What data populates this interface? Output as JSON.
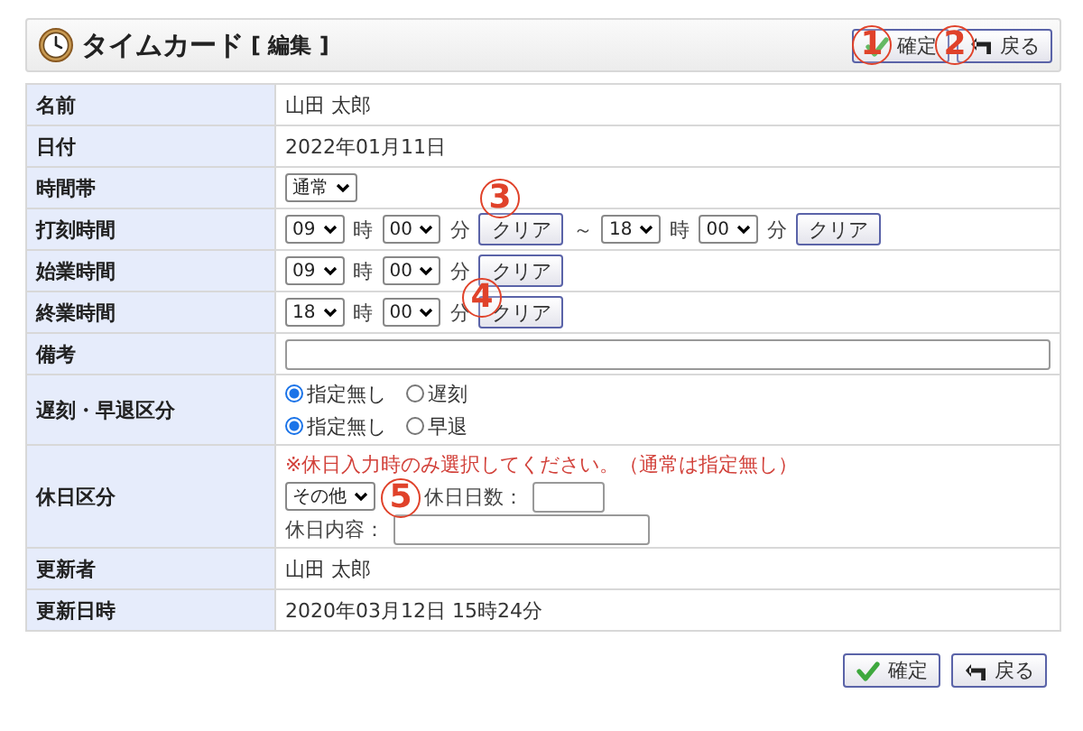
{
  "header": {
    "title": "タイムカード",
    "mode": "[ 編集 ]",
    "buttons": [
      {
        "kind": "confirm",
        "label": "確定"
      },
      {
        "kind": "back",
        "label": "戻る"
      }
    ]
  },
  "rows": [
    {
      "label": "名前",
      "kind": "text",
      "value": "山田 太郎"
    },
    {
      "label": "日付",
      "kind": "text",
      "value": "2022年01月11日"
    },
    {
      "label": "時間帯",
      "kind": "controls",
      "lines": [
        [
          {
            "kind": "select",
            "value": "通常"
          }
        ]
      ]
    },
    {
      "label": "打刻時間",
      "kind": "controls",
      "lines": [
        [
          {
            "kind": "select",
            "value": "09"
          },
          {
            "kind": "unit",
            "text": "時"
          },
          {
            "kind": "select",
            "value": "00"
          },
          {
            "kind": "unit",
            "text": "分"
          },
          {
            "kind": "button",
            "text": "クリア"
          },
          {
            "kind": "unit",
            "text": "～"
          },
          {
            "kind": "select",
            "value": "18"
          },
          {
            "kind": "unit",
            "text": "時"
          },
          {
            "kind": "select",
            "value": "00"
          },
          {
            "kind": "unit",
            "text": "分"
          },
          {
            "kind": "button",
            "text": "クリア"
          }
        ]
      ]
    },
    {
      "label": "始業時間",
      "kind": "controls",
      "lines": [
        [
          {
            "kind": "select",
            "value": "09"
          },
          {
            "kind": "unit",
            "text": "時"
          },
          {
            "kind": "select",
            "value": "00"
          },
          {
            "kind": "unit",
            "text": "分"
          },
          {
            "kind": "button",
            "text": "クリア"
          }
        ]
      ]
    },
    {
      "label": "終業時間",
      "kind": "controls",
      "lines": [
        [
          {
            "kind": "select",
            "value": "18"
          },
          {
            "kind": "unit",
            "text": "時"
          },
          {
            "kind": "select",
            "value": "00"
          },
          {
            "kind": "unit",
            "text": "分"
          },
          {
            "kind": "button",
            "text": "クリア"
          }
        ]
      ]
    },
    {
      "label": "備考",
      "kind": "controls",
      "lines": [
        [
          {
            "kind": "wide_input"
          }
        ]
      ]
    },
    {
      "label": "遅刻・早退区分",
      "kind": "controls",
      "lines": [
        [
          {
            "kind": "radio",
            "text": "指定無し",
            "selected": true
          },
          {
            "kind": "radio",
            "text": "遅刻",
            "selected": false
          }
        ],
        [
          {
            "kind": "radio",
            "text": "指定無し",
            "selected": true
          },
          {
            "kind": "radio",
            "text": "早退",
            "selected": false
          }
        ]
      ]
    },
    {
      "label": "休日区分",
      "kind": "controls",
      "lines": [
        [
          {
            "kind": "note",
            "text": "※休日入力時のみ選択してください。（通常は指定無し）"
          }
        ],
        [
          {
            "kind": "select",
            "value": "その他"
          },
          {
            "kind": "unit",
            "text": "休日日数："
          },
          {
            "kind": "short_input"
          }
        ],
        [
          {
            "kind": "unit",
            "text": "休日内容："
          },
          {
            "kind": "input"
          }
        ]
      ]
    },
    {
      "label": "更新者",
      "kind": "text",
      "value": "山田 太郎"
    },
    {
      "label": "更新日時",
      "kind": "text",
      "value": "2020年03月12日 15時24分"
    }
  ],
  "footer_buttons": [
    {
      "kind": "confirm",
      "label": "確定"
    },
    {
      "kind": "back",
      "label": "戻る"
    }
  ],
  "markers": [
    {
      "text": "1"
    },
    {
      "text": "2"
    },
    {
      "text": "3"
    },
    {
      "text": "4"
    },
    {
      "text": "5"
    }
  ]
}
